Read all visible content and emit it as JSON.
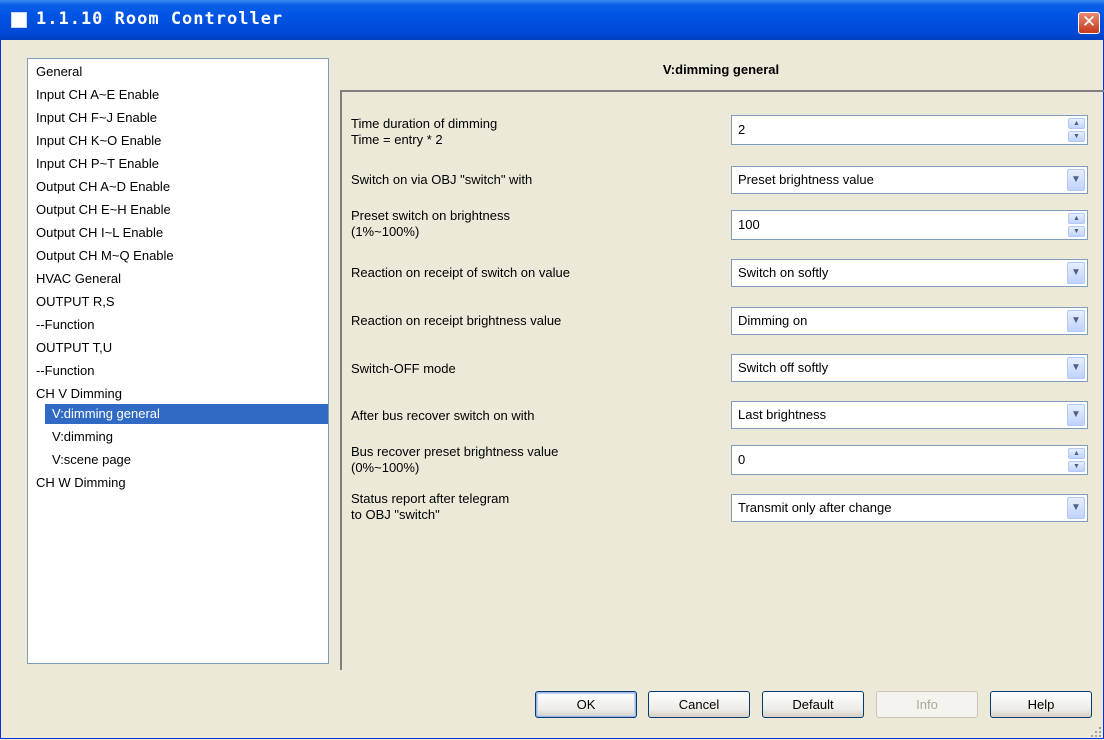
{
  "window": {
    "title": "1.1.10 Room Controller"
  },
  "tree": {
    "items": [
      {
        "label": "General"
      },
      {
        "label": "Input CH A~E Enable"
      },
      {
        "label": "Input CH F~J Enable"
      },
      {
        "label": "Input CH K~O Enable"
      },
      {
        "label": "Input CH P~T Enable"
      },
      {
        "label": "Output CH A~D Enable"
      },
      {
        "label": "Output CH E~H Enable"
      },
      {
        "label": "Output CH I~L Enable"
      },
      {
        "label": "Output CH M~Q Enable"
      },
      {
        "label": "HVAC General"
      },
      {
        "label": "OUTPUT R,S"
      },
      {
        "label": "--Function"
      },
      {
        "label": "OUTPUT T,U"
      },
      {
        "label": "--Function"
      },
      {
        "label": "CH V Dimming"
      },
      {
        "label": "V:dimming general",
        "selected": true
      },
      {
        "label": "V:dimming"
      },
      {
        "label": "V:scene page"
      },
      {
        "label": "CH W Dimming"
      }
    ]
  },
  "panel": {
    "title": "V:dimming general",
    "params": [
      {
        "label_1": "Time duration of dimming",
        "label_2": "Time = entry * 2",
        "type": "spin",
        "value": "2"
      },
      {
        "label_1": "Switch on via OBJ \"switch\" with",
        "type": "combo",
        "value": "Preset brightness value"
      },
      {
        "label_1": "Preset switch on brightness",
        "label_2": "(1%~100%)",
        "type": "spin",
        "value": "100"
      },
      {
        "label_1": "Reaction on receipt of switch on value",
        "type": "combo",
        "value": "Switch on softly"
      },
      {
        "label_1": "Reaction on receipt brightness value",
        "type": "combo",
        "value": "Dimming on"
      },
      {
        "label_1": "Switch-OFF mode",
        "type": "combo",
        "value": "Switch off softly"
      },
      {
        "label_1": "After bus recover switch on with",
        "type": "combo",
        "value": "Last brightness"
      },
      {
        "label_1": "Bus recover preset brightness value",
        "label_2": "(0%~100%)",
        "type": "spin",
        "value": "0"
      },
      {
        "label_1": "Status report after telegram",
        "label_2": "to OBJ \"switch\"",
        "type": "combo",
        "value": "Transmit only after change"
      }
    ]
  },
  "buttons": {
    "ok": "OK",
    "cancel": "Cancel",
    "default": "Default",
    "info": "Info",
    "help": "Help"
  },
  "icons": {
    "spin_up": "▲",
    "spin_down": "▼",
    "dropdown": "▼",
    "close": "✕"
  }
}
